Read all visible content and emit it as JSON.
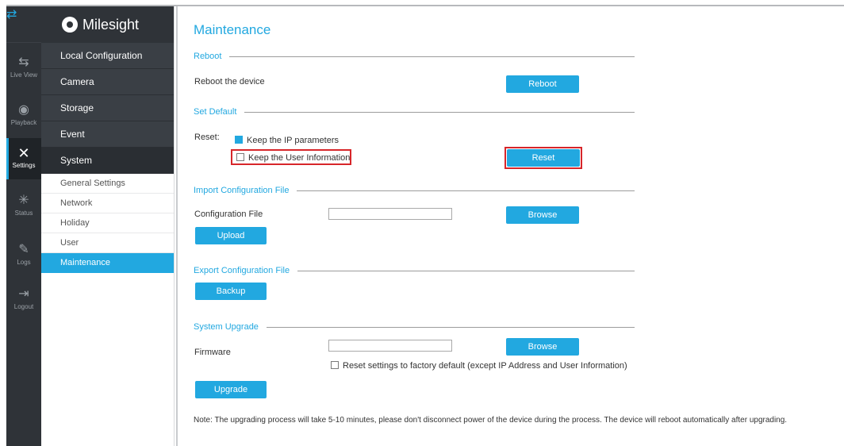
{
  "rail": {
    "items": [
      {
        "label": "Live View",
        "icon": "swap-icon"
      },
      {
        "label": "Playback",
        "icon": "playback-icon"
      },
      {
        "label": "Settings",
        "icon": "tools-icon"
      },
      {
        "label": "Status",
        "icon": "status-icon"
      },
      {
        "label": "Logs",
        "icon": "logs-icon"
      },
      {
        "label": "Logout",
        "icon": "logout-icon"
      }
    ]
  },
  "brand": {
    "name": "Milesight"
  },
  "menu": {
    "items": [
      "Local Configuration",
      "Camera",
      "Storage",
      "Event",
      "System"
    ],
    "submenu": [
      "General Settings",
      "Network",
      "Holiday",
      "User",
      "Maintenance"
    ]
  },
  "page": {
    "title": "Maintenance",
    "reboot": {
      "section": "Reboot",
      "label": "Reboot the device",
      "button": "Reboot"
    },
    "set_default": {
      "section": "Set Default",
      "reset_label": "Reset:",
      "keep_ip": "Keep the IP parameters",
      "keep_ip_checked": true,
      "keep_user": "Keep the User Information",
      "keep_user_checked": false,
      "button": "Reset"
    },
    "import": {
      "section": "Import Configuration File",
      "label": "Configuration File",
      "file_value": "",
      "browse": "Browse",
      "upload": "Upload"
    },
    "export": {
      "section": "Export Configuration File",
      "backup": "Backup"
    },
    "upgrade": {
      "section": "System Upgrade",
      "label": "Firmware",
      "file_value": "",
      "browse": "Browse",
      "factory_reset": "Reset settings to factory default (except IP Address and User Information)",
      "factory_reset_checked": false,
      "button": "Upgrade"
    },
    "note": "Note: The upgrading process will take 5-10 minutes, please don't disconnect power of the device during the process. The device will reboot automatically after upgrading."
  },
  "colors": {
    "accent": "#22a8e0",
    "highlight": "#d7262a",
    "sidebar": "#2f3338"
  }
}
